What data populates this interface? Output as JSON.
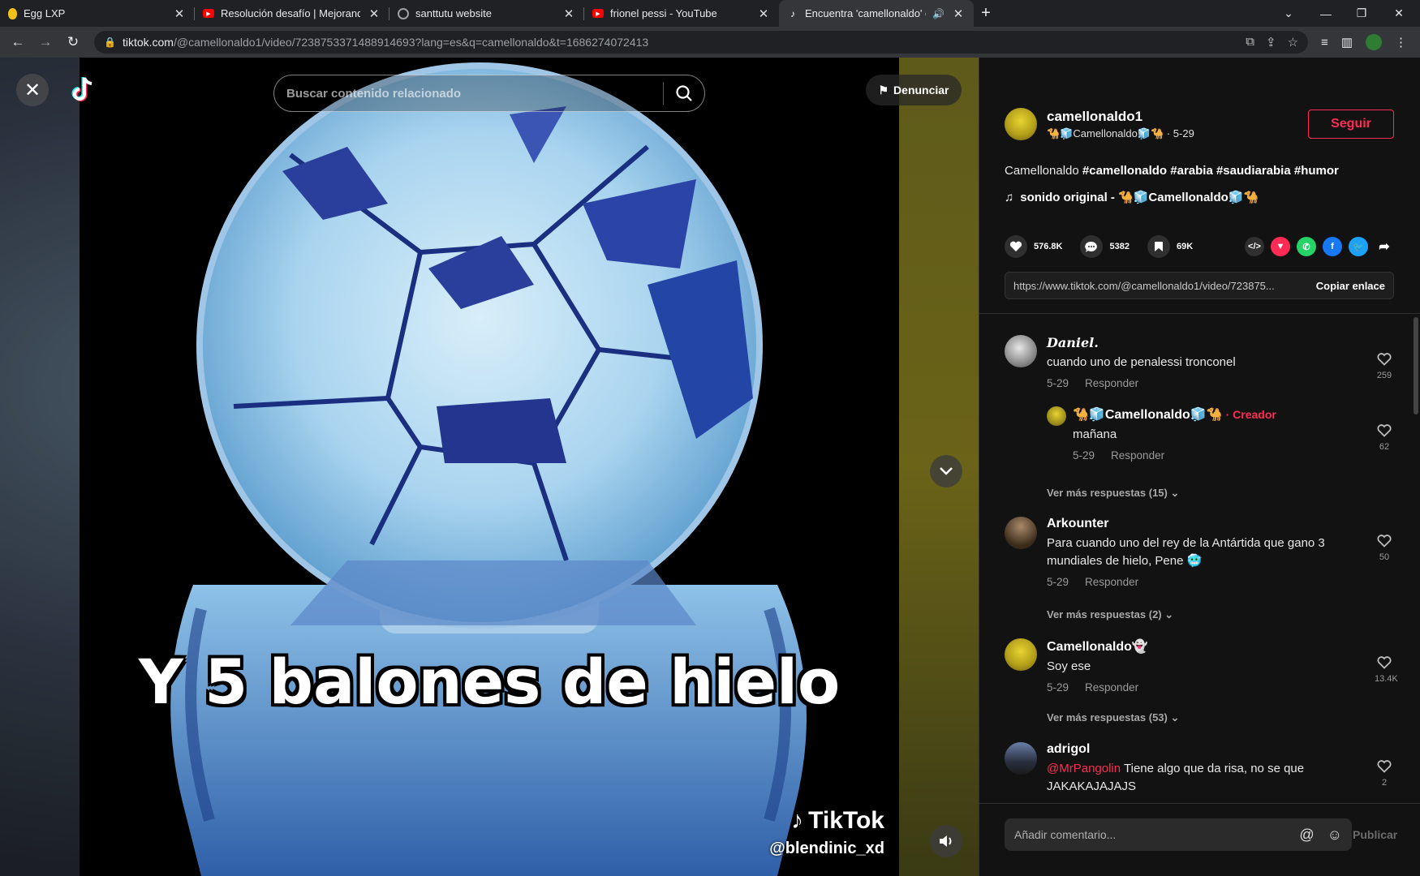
{
  "browser": {
    "tabs": [
      {
        "label": "Egg LXP",
        "favicon": "egg-icon",
        "color": "#f2c01a"
      },
      {
        "label": "Resolución desafío | Mejorando e",
        "favicon": "youtube-icon",
        "color": "#ff0000"
      },
      {
        "label": "santtutu website",
        "favicon": "globe-icon",
        "color": "#9aa0a6"
      },
      {
        "label": "frionel pessi - YouTube",
        "favicon": "youtube-icon",
        "color": "#ff0000"
      },
      {
        "label": "Encuentra 'camellonaldo' en",
        "favicon": "tiktok-icon",
        "color": "#ffffff",
        "active": true
      }
    ],
    "url_host": "tiktok.com",
    "url_path": "/@camellonaldo1/video/7238753371488914693?lang=es&q=camellonaldo&t=1686274072413"
  },
  "video": {
    "search_placeholder": "Buscar contenido relacionado",
    "report_label": "Denunciar",
    "caption": "Y 5 balones de hielo",
    "watermark_brand": "TikTok",
    "watermark_user": "@blendinic_xd"
  },
  "post": {
    "author_name": "camellonaldo1",
    "author_display": "🐪🧊Camellonaldo🧊🐪 · 5-29",
    "follow_label": "Seguir",
    "description_prefix": "Camellonaldo ",
    "hashtags": "#camellonaldo #arabia #saudiarabia #humor",
    "music": "sonido original - 🐪🧊Camellonaldo🧊🐪",
    "likes": "576.8K",
    "comments": "5382",
    "saves": "69K",
    "link": "https://www.tiktok.com/@camellonaldo1/video/723875...",
    "copy_label": "Copiar enlace"
  },
  "comments": [
    {
      "name": "𝑫𝒂𝒏𝒊𝒆𝒍.",
      "text": "cuando uno de penalessi tronconel",
      "date": "5-29",
      "reply": "Responder",
      "likes": "259"
    },
    {
      "name": "🐪🧊Camellonaldo🧊🐪",
      "creator": "· Creador",
      "text": "mañana",
      "date": "5-29",
      "reply": "Responder",
      "likes": "62"
    },
    {
      "more": "Ver más respuestas (15)"
    },
    {
      "name": "Arkounter",
      "text": "Para cuando uno del rey de la Antártida que gano 3 mundiales de hielo, Pene 🥶",
      "date": "5-29",
      "reply": "Responder",
      "likes": "50"
    },
    {
      "more": "Ver más respuestas (2)"
    },
    {
      "name": "Camellonaldo👻",
      "text": "Soy ese",
      "date": "5-29",
      "reply": "Responder",
      "likes": "13.4K"
    },
    {
      "more": "Ver más respuestas (53)"
    },
    {
      "name": "adrigol",
      "mention": "@MrPangolin",
      "text": " Tiene algo que da risa, no se que JAKAKAJAJAJS",
      "likes": "2"
    }
  ],
  "input": {
    "placeholder": "Añadir comentario...",
    "publish_label": "Publicar"
  }
}
